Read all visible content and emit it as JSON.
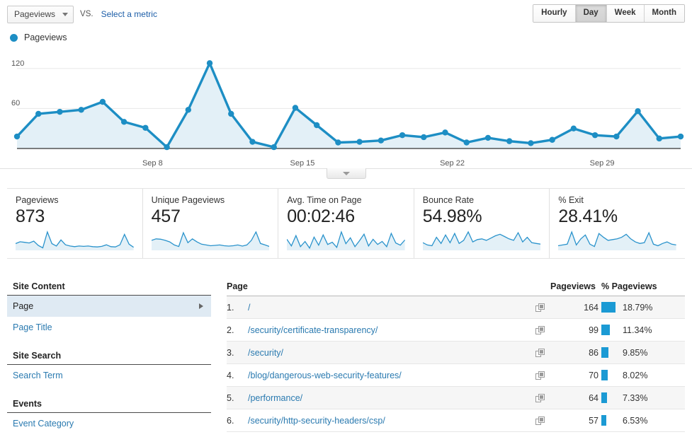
{
  "toolbar": {
    "metric_selected": "Pageviews",
    "vs_label": "VS.",
    "select_metric_link": "Select a metric",
    "periods": [
      {
        "label": "Hourly",
        "active": false
      },
      {
        "label": "Day",
        "active": true
      },
      {
        "label": "Week",
        "active": false
      },
      {
        "label": "Month",
        "active": false
      }
    ]
  },
  "chart_data": {
    "type": "area",
    "title": "Pageviews",
    "legend": [
      "Pageviews"
    ],
    "legend_position": "top-left",
    "xlabel": "",
    "ylabel": "",
    "grid": true,
    "ylim": [
      0,
      140
    ],
    "yticks": [
      60,
      120
    ],
    "ytick_labels": [
      "60",
      "120"
    ],
    "xtick_labels": [
      "Sep 8",
      "Sep 15",
      "Sep 22",
      "Sep 29"
    ],
    "xtick_indices": [
      6,
      13,
      20,
      27
    ],
    "series": [
      {
        "name": "Pageviews",
        "color": "#1d8ec4",
        "fill": "#e3f0f7",
        "values": [
          18,
          52,
          55,
          58,
          70,
          40,
          31,
          2,
          58,
          128,
          52,
          10,
          2,
          61,
          35,
          9,
          10,
          12,
          20,
          17,
          24,
          9,
          16,
          11,
          8,
          13,
          30,
          20,
          18,
          56,
          15,
          18
        ]
      }
    ]
  },
  "collapse_tab": {
    "icon": "chevron-down-icon"
  },
  "cards": [
    {
      "label": "Pageviews",
      "value": "873",
      "spark": [
        22,
        28,
        26,
        24,
        30,
        16,
        8,
        60,
        22,
        14,
        34,
        18,
        14,
        12,
        14,
        13,
        14,
        12,
        11,
        13,
        18,
        12,
        11,
        18,
        52,
        20,
        10
      ]
    },
    {
      "label": "Unique Pageviews",
      "value": "457",
      "spark": [
        26,
        30,
        29,
        26,
        22,
        14,
        10,
        46,
        20,
        30,
        22,
        16,
        14,
        12,
        13,
        14,
        12,
        11,
        12,
        14,
        11,
        14,
        26,
        48,
        18,
        14,
        10
      ]
    },
    {
      "label": "Avg. Time on Page",
      "value": "00:02:46",
      "spark": [
        30,
        12,
        40,
        10,
        24,
        6,
        36,
        14,
        42,
        16,
        22,
        8,
        50,
        18,
        34,
        10,
        26,
        44,
        12,
        30,
        16,
        24,
        10,
        46,
        20,
        14,
        28
      ]
    },
    {
      "label": "Bounce Rate",
      "value": "54.98%",
      "spark": [
        20,
        14,
        12,
        34,
        18,
        40,
        20,
        44,
        18,
        26,
        48,
        22,
        28,
        30,
        26,
        32,
        38,
        42,
        36,
        30,
        26,
        46,
        22,
        34,
        20,
        18,
        16
      ]
    },
    {
      "label": "% Exit",
      "value": "28.41%",
      "spark": [
        12,
        14,
        16,
        48,
        14,
        30,
        40,
        16,
        10,
        44,
        34,
        26,
        28,
        30,
        34,
        42,
        30,
        22,
        18,
        20,
        46,
        16,
        12,
        18,
        22,
        16,
        14
      ]
    }
  ],
  "sidebar": {
    "groups": [
      {
        "title": "Site Content",
        "items": [
          {
            "label": "Page",
            "selected": true,
            "has_arrow": true
          },
          {
            "label": "Page Title",
            "selected": false,
            "has_arrow": false
          }
        ]
      },
      {
        "title": "Site Search",
        "items": [
          {
            "label": "Search Term",
            "selected": false,
            "has_arrow": false
          }
        ]
      },
      {
        "title": "Events",
        "items": [
          {
            "label": "Event Category",
            "selected": false,
            "has_arrow": false
          }
        ]
      }
    ]
  },
  "table": {
    "columns": {
      "page": "Page",
      "pageviews": "Pageviews",
      "pct_pageviews": "% Pageviews"
    },
    "row_icon": "open-in-new-window-icon",
    "bar_color": "#1b9ad4",
    "rows": [
      {
        "index": "1.",
        "page": "/",
        "pageviews": "164",
        "pct": "18.79%",
        "pct_value": 18.79
      },
      {
        "index": "2.",
        "page": "/security/certificate-transparency/",
        "pageviews": "99",
        "pct": "11.34%",
        "pct_value": 11.34
      },
      {
        "index": "3.",
        "page": "/security/",
        "pageviews": "86",
        "pct": "9.85%",
        "pct_value": 9.85
      },
      {
        "index": "4.",
        "page": "/blog/dangerous-web-security-features/",
        "pageviews": "70",
        "pct": "8.02%",
        "pct_value": 8.02
      },
      {
        "index": "5.",
        "page": "/performance/",
        "pageviews": "64",
        "pct": "7.33%",
        "pct_value": 7.33
      },
      {
        "index": "6.",
        "page": "/security/http-security-headers/csp/",
        "pageviews": "57",
        "pct": "6.53%",
        "pct_value": 6.53
      }
    ]
  }
}
